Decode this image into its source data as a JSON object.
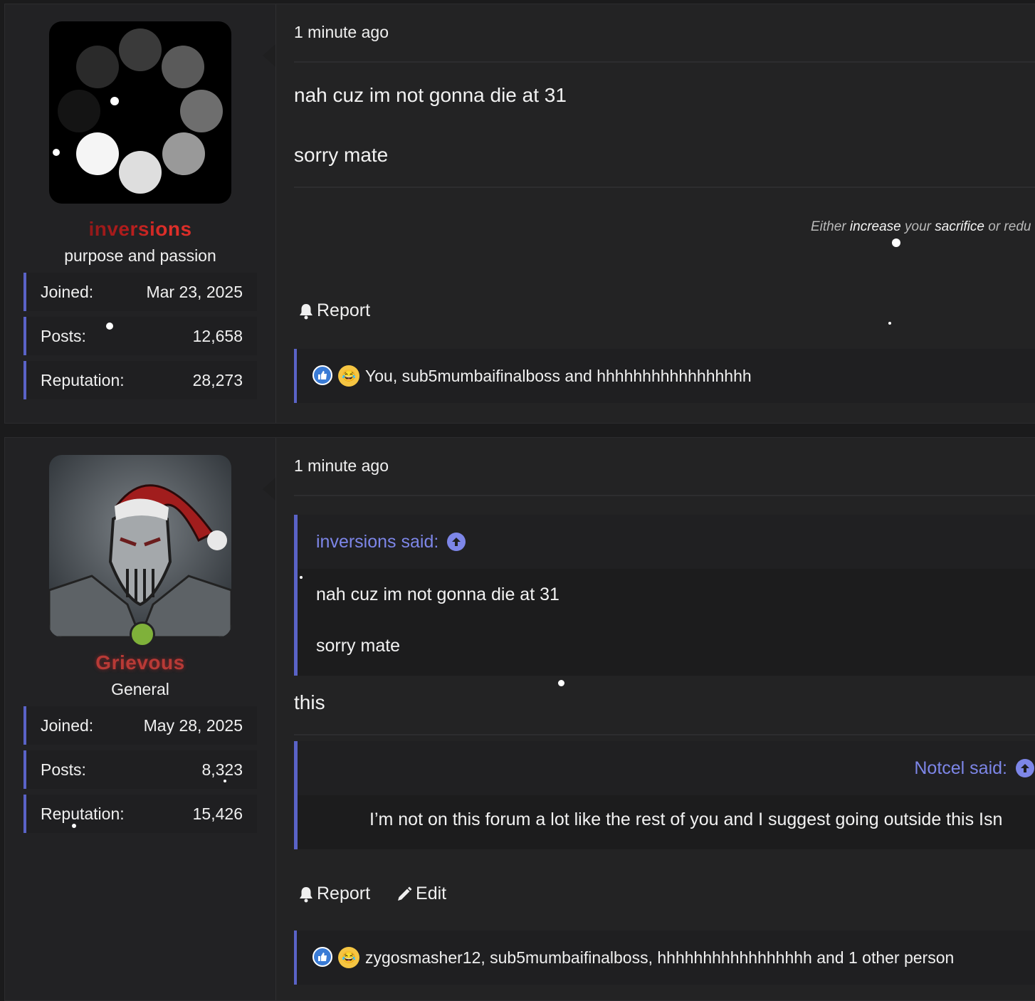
{
  "posts": [
    {
      "time": "1 minute ago",
      "user": {
        "name": "inversions",
        "title": "purpose and passion",
        "stats": [
          {
            "label": "Joined:",
            "value": "Mar 23, 2025"
          },
          {
            "label": "Posts:",
            "value": "12,658"
          },
          {
            "label": "Reputation:",
            "value": "28,273"
          }
        ]
      },
      "body": [
        "nah cuz im not gonna die at 31",
        "sorry mate"
      ],
      "signature_pre": "Either ",
      "signature_b1": "increase",
      "signature_mid": " your ",
      "signature_b2": "sacrifice",
      "signature_post": " or redu",
      "actions": {
        "report": "Report"
      },
      "reactions": "You, sub5mumbaifinalboss and hhhhhhhhhhhhhhhhh"
    },
    {
      "time": "1 minute ago",
      "user": {
        "name": "Grievous",
        "title": "General",
        "stats": [
          {
            "label": "Joined:",
            "value": "May 28, 2025"
          },
          {
            "label": "Posts:",
            "value": "8,323"
          },
          {
            "label": "Reputation:",
            "value": "15,426"
          }
        ]
      },
      "quote1": {
        "author": "inversions said:",
        "lines": [
          "nah cuz im not gonna die at 31",
          "sorry mate"
        ]
      },
      "reply": "this",
      "quote2": {
        "author": "Notcel said:",
        "text": "I’m not on this forum a lot like the rest of you and I suggest going outside this Isn"
      },
      "actions": {
        "report": "Report",
        "edit": "Edit"
      },
      "reactions": "zygosmasher12, sub5mumbaifinalboss, hhhhhhhhhhhhhhhhh and 1 other person"
    }
  ],
  "colors": {
    "accent": "#5a63c7",
    "quote_link": "#7d86e8",
    "online": "#7fb13a"
  }
}
